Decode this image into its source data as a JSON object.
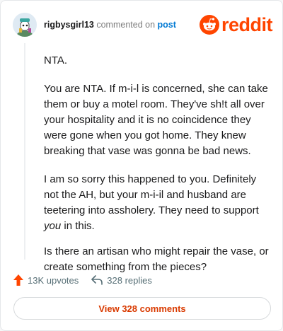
{
  "header": {
    "username": "rigbysgirl13",
    "action_text": "commented on",
    "post_link": "post",
    "logo_text": "reddit"
  },
  "comment": {
    "paragraphs": [
      "NTA.",
      "You are NTA. If m-i-l is concerned, she can take them or buy a motel room. They've sh!t all over your hospitality and it is no coincidence they were gone when you got home. They knew breaking that vase was gonna be bad news.",
      "Is there an artisan who might repair the vase, or create something from the pieces?"
    ],
    "p3_before": "I am so sorry this happened to you. Definitely not the AH, but your m-i-il and husband are teetering into assholery. They need to support ",
    "p3_emph": "you",
    "p3_after": " in this."
  },
  "actions": {
    "upvotes": "13K upvotes",
    "replies": "328 replies"
  },
  "view_comments": "View 328 comments",
  "colors": {
    "brand": "#ff4500",
    "link": "#0079d3",
    "action_gray": "#576f76",
    "button_text": "#d93a00"
  },
  "icons": [
    "avatar-icon",
    "reddit-snoo-icon",
    "upvote-arrow-icon",
    "reply-arrow-icon"
  ]
}
